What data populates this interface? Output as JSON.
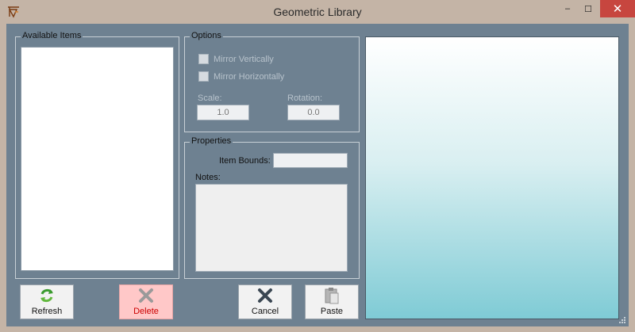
{
  "window": {
    "title": "Geometric Library",
    "controls": {
      "minimize": "‒",
      "maximize": "☐",
      "close": "✕"
    }
  },
  "available_items": {
    "group_label": "Available Items",
    "items": []
  },
  "options": {
    "group_label": "Options",
    "mirror_vertically": {
      "label": "Mirror Vertically",
      "checked": false,
      "enabled": false
    },
    "mirror_horizontally": {
      "label": "Mirror Horizontally",
      "checked": false,
      "enabled": false
    },
    "scale": {
      "label": "Scale:",
      "value": "1.0",
      "enabled": false
    },
    "rotation": {
      "label": "Rotation:",
      "value": "0.0",
      "enabled": false
    }
  },
  "properties": {
    "group_label": "Properties",
    "item_bounds": {
      "label": "Item Bounds:",
      "value": ""
    },
    "notes": {
      "label": "Notes:",
      "value": ""
    }
  },
  "buttons": {
    "refresh": "Refresh",
    "delete": "Delete",
    "cancel": "Cancel",
    "paste": "Paste"
  },
  "icons": {
    "app": "app-icon",
    "refresh": "refresh-icon",
    "delete": "delete-icon",
    "cancel": "cancel-icon",
    "paste": "paste-icon"
  },
  "colors": {
    "titlebar": "#c4b4a6",
    "client_background": "#6e8191",
    "close_button": "#c7463f",
    "delete_button": "#ffc8c8",
    "preview_top": "#ffffff",
    "preview_bottom": "#7fcbd5"
  }
}
